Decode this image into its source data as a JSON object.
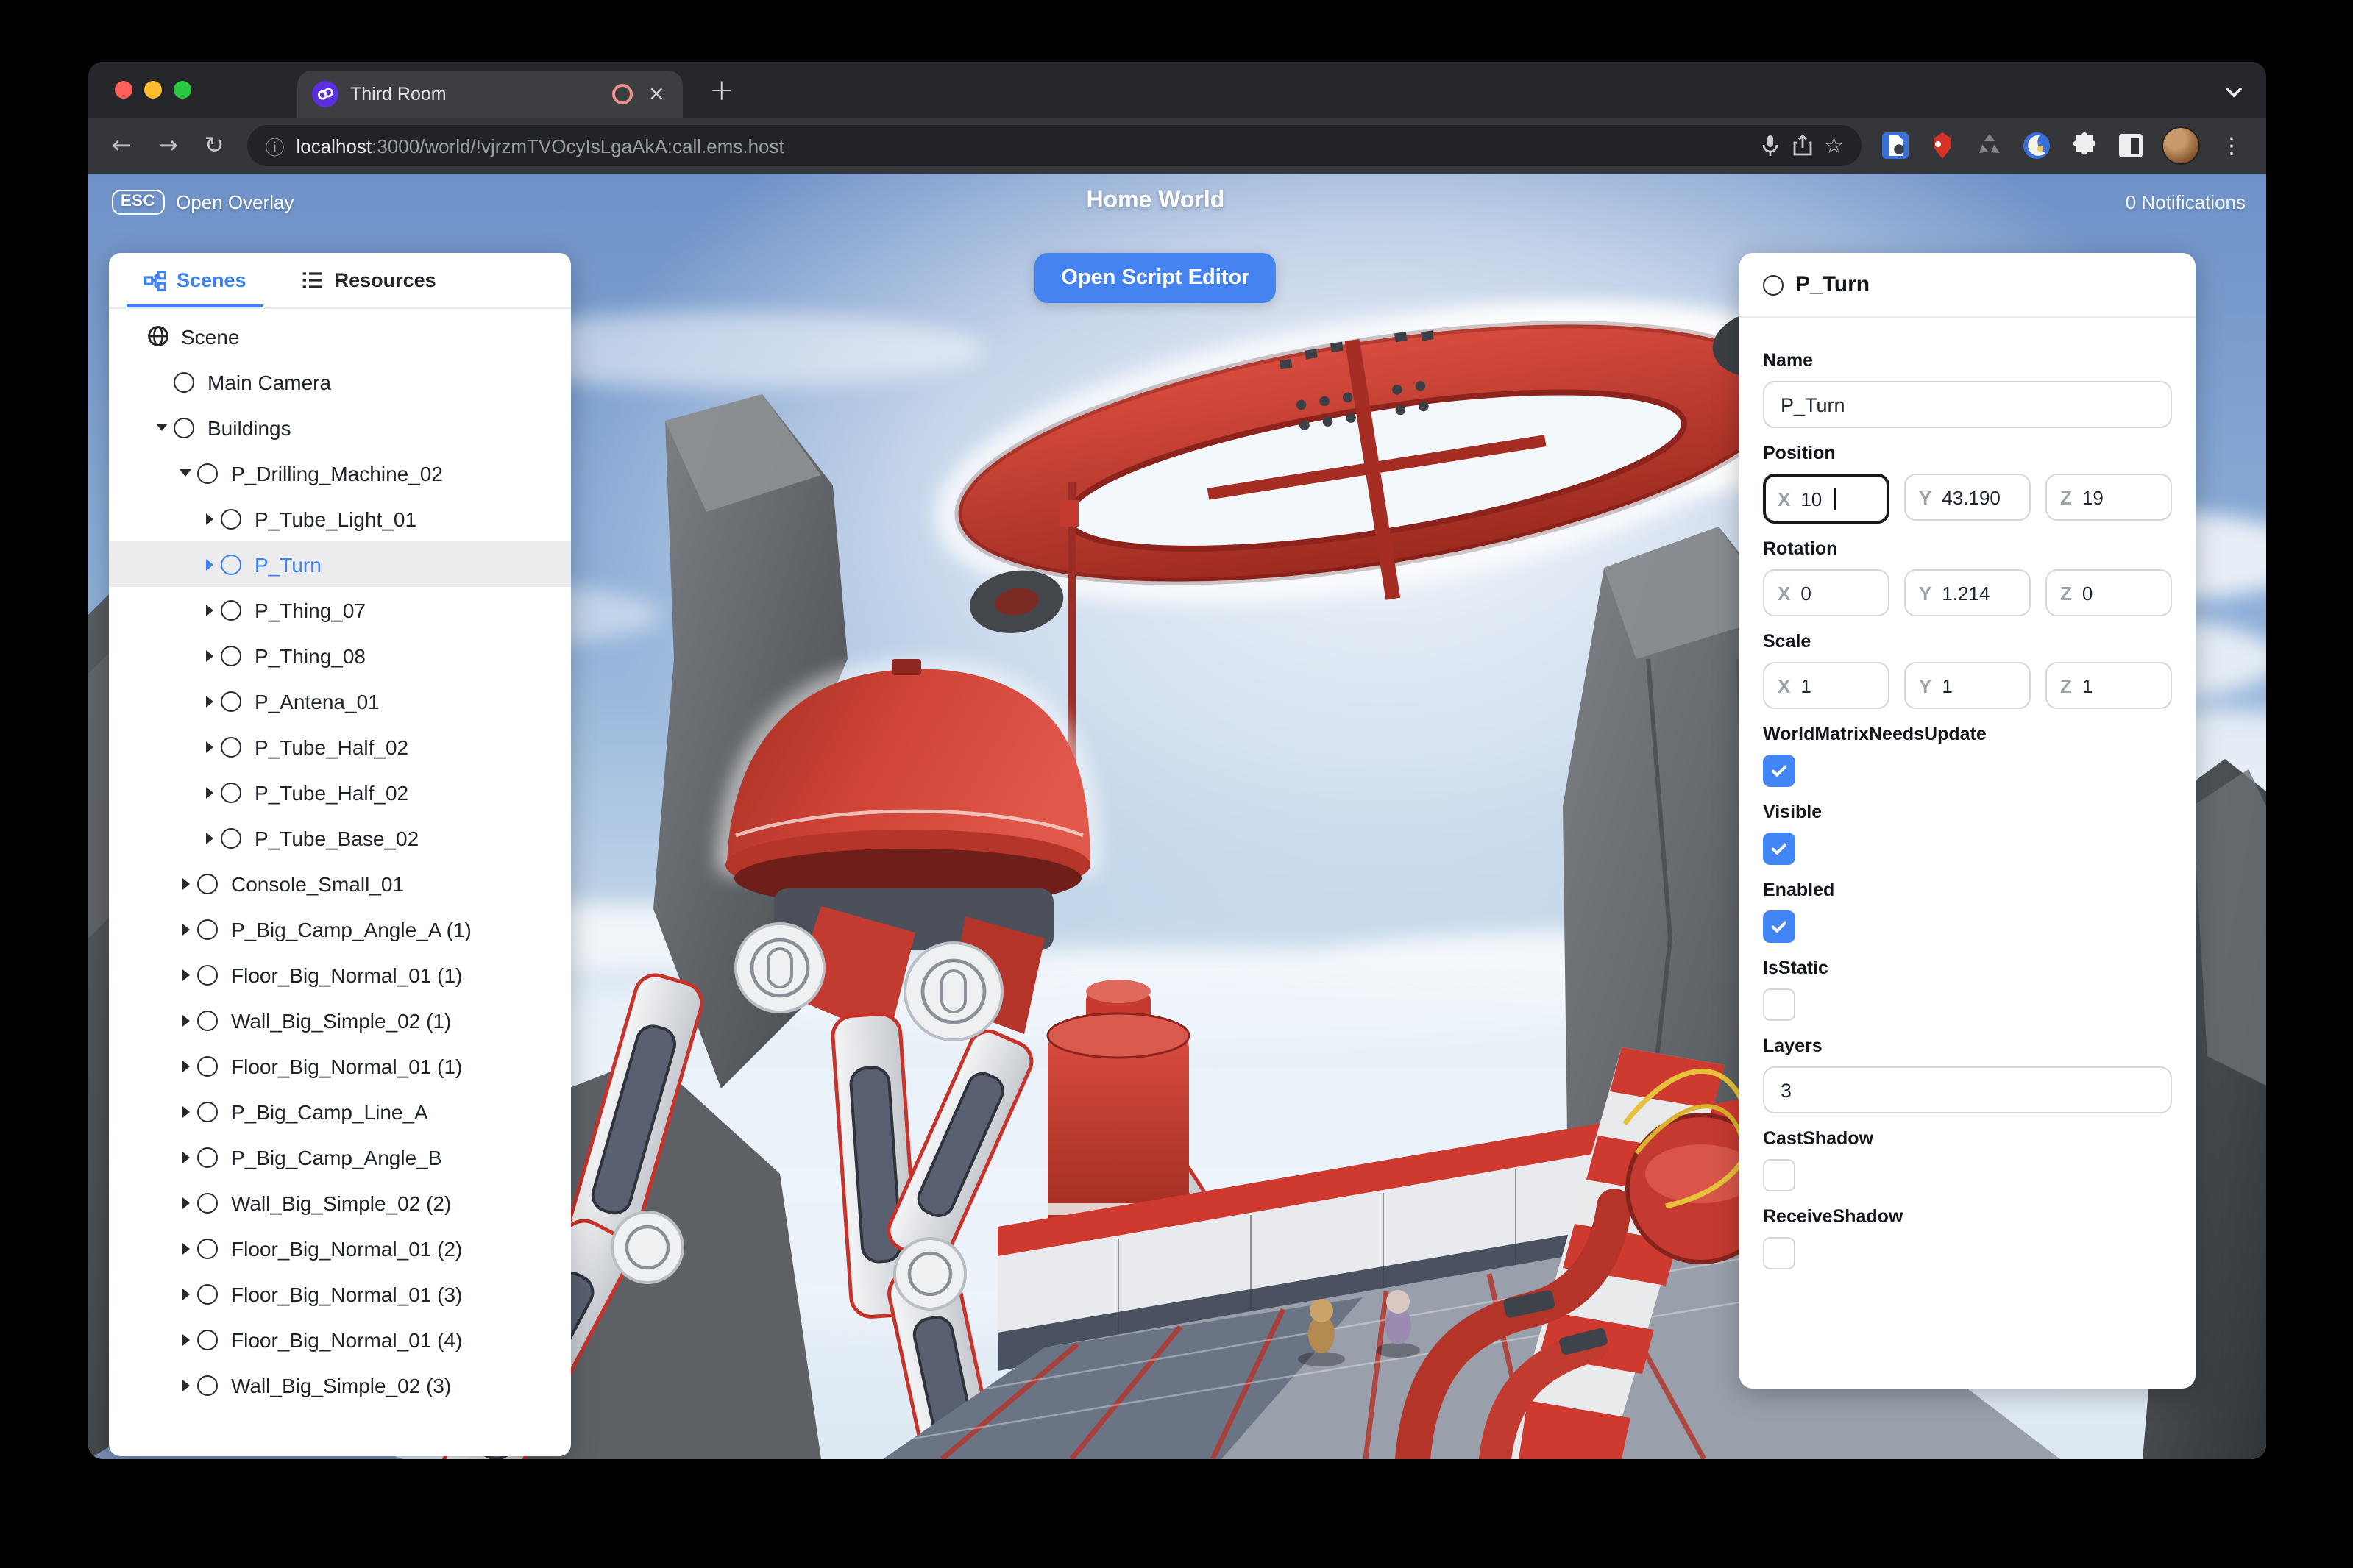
{
  "browser": {
    "tab_title": "Third Room",
    "url": {
      "host": "localhost",
      "rest": ":3000/world/!vjrzmTVOcyIsLgaAkA:call.ems.host"
    },
    "icons": {
      "back": "←",
      "forward": "→",
      "reload": "↻",
      "info": "ⓘ",
      "bookmark": "☆",
      "tab_close": "×",
      "new_tab": "+",
      "menu": "⋮"
    },
    "extension_icon_names": [
      "microphone-icon",
      "share-icon",
      "bookmark-star-icon",
      "password-manager-extension-icon",
      "red-extension-icon",
      "recycle-extension-icon",
      "dark-reader-extension-icon",
      "puzzle-extensions-icon",
      "sidebar-icon",
      "profile-avatar",
      "menu-dots-icon"
    ]
  },
  "overlay": {
    "esc_key": "ESC",
    "open_overlay": "Open Overlay",
    "world_title": "Home World",
    "notifications": "0 Notifications",
    "open_script_editor": "Open Script Editor"
  },
  "scene_panel": {
    "tabs": [
      {
        "label": "Scenes",
        "active": true
      },
      {
        "label": "Resources",
        "active": false
      }
    ],
    "tree": [
      {
        "label": "Scene",
        "depth": 0,
        "icon": "globe",
        "arrow": null,
        "selected": false
      },
      {
        "label": "Main Camera",
        "depth": 1,
        "icon": "node",
        "arrow": null,
        "selected": false
      },
      {
        "label": "Buildings",
        "depth": 1,
        "icon": "node",
        "arrow": "down",
        "selected": false
      },
      {
        "label": "P_Drilling_Machine_02",
        "depth": 2,
        "icon": "node",
        "arrow": "down",
        "selected": false
      },
      {
        "label": "P_Tube_Light_01",
        "depth": 3,
        "icon": "node",
        "arrow": "right",
        "selected": false
      },
      {
        "label": "P_Turn",
        "depth": 3,
        "icon": "node",
        "arrow": "right",
        "selected": true
      },
      {
        "label": "P_Thing_07",
        "depth": 3,
        "icon": "node",
        "arrow": "right",
        "selected": false
      },
      {
        "label": "P_Thing_08",
        "depth": 3,
        "icon": "node",
        "arrow": "right",
        "selected": false
      },
      {
        "label": "P_Antena_01",
        "depth": 3,
        "icon": "node",
        "arrow": "right",
        "selected": false
      },
      {
        "label": "P_Tube_Half_02",
        "depth": 3,
        "icon": "node",
        "arrow": "right",
        "selected": false
      },
      {
        "label": "P_Tube_Half_02",
        "depth": 3,
        "icon": "node",
        "arrow": "right",
        "selected": false
      },
      {
        "label": "P_Tube_Base_02",
        "depth": 3,
        "icon": "node",
        "arrow": "right",
        "selected": false
      },
      {
        "label": "Console_Small_01",
        "depth": 2,
        "icon": "node",
        "arrow": "right",
        "selected": false
      },
      {
        "label": "P_Big_Camp_Angle_A (1)",
        "depth": 2,
        "icon": "node",
        "arrow": "right",
        "selected": false
      },
      {
        "label": "Floor_Big_Normal_01 (1)",
        "depth": 2,
        "icon": "node",
        "arrow": "right",
        "selected": false
      },
      {
        "label": "Wall_Big_Simple_02 (1)",
        "depth": 2,
        "icon": "node",
        "arrow": "right",
        "selected": false
      },
      {
        "label": "Floor_Big_Normal_01 (1)",
        "depth": 2,
        "icon": "node",
        "arrow": "right",
        "selected": false
      },
      {
        "label": "P_Big_Camp_Line_A",
        "depth": 2,
        "icon": "node",
        "arrow": "right",
        "selected": false
      },
      {
        "label": "P_Big_Camp_Angle_B",
        "depth": 2,
        "icon": "node",
        "arrow": "right",
        "selected": false
      },
      {
        "label": "Wall_Big_Simple_02 (2)",
        "depth": 2,
        "icon": "node",
        "arrow": "right",
        "selected": false
      },
      {
        "label": "Floor_Big_Normal_01 (2)",
        "depth": 2,
        "icon": "node",
        "arrow": "right",
        "selected": false
      },
      {
        "label": "Floor_Big_Normal_01 (3)",
        "depth": 2,
        "icon": "node",
        "arrow": "right",
        "selected": false
      },
      {
        "label": "Floor_Big_Normal_01 (4)",
        "depth": 2,
        "icon": "node",
        "arrow": "right",
        "selected": false
      },
      {
        "label": "Wall_Big_Simple_02 (3)",
        "depth": 2,
        "icon": "node",
        "arrow": "right",
        "selected": false
      }
    ]
  },
  "inspector": {
    "title": "P_Turn",
    "axis": {
      "x": "X",
      "y": "Y",
      "z": "Z"
    },
    "name": {
      "label": "Name",
      "value": "P_Turn"
    },
    "position": {
      "label": "Position",
      "x": "10",
      "y": "43.190",
      "z": "19"
    },
    "rotation": {
      "label": "Rotation",
      "x": "0",
      "y": "1.214",
      "z": "0"
    },
    "scale": {
      "label": "Scale",
      "x": "1",
      "y": "1",
      "z": "1"
    },
    "checks": [
      {
        "label": "WorldMatrixNeedsUpdate",
        "checked": true
      },
      {
        "label": "Visible",
        "checked": true
      },
      {
        "label": "Enabled",
        "checked": true
      },
      {
        "label": "IsStatic",
        "checked": false
      },
      {
        "label": "CastShadow",
        "checked": false
      },
      {
        "label": "ReceiveShadow",
        "checked": false
      }
    ],
    "layers": {
      "label": "Layers",
      "value": "3"
    }
  },
  "colors": {
    "accent_blue": "#3b82f6",
    "button_blue": "#4583f1",
    "checkbox_blue": "#4285f4",
    "machine_red": "#c0392e",
    "selected_row": "#ececee"
  }
}
